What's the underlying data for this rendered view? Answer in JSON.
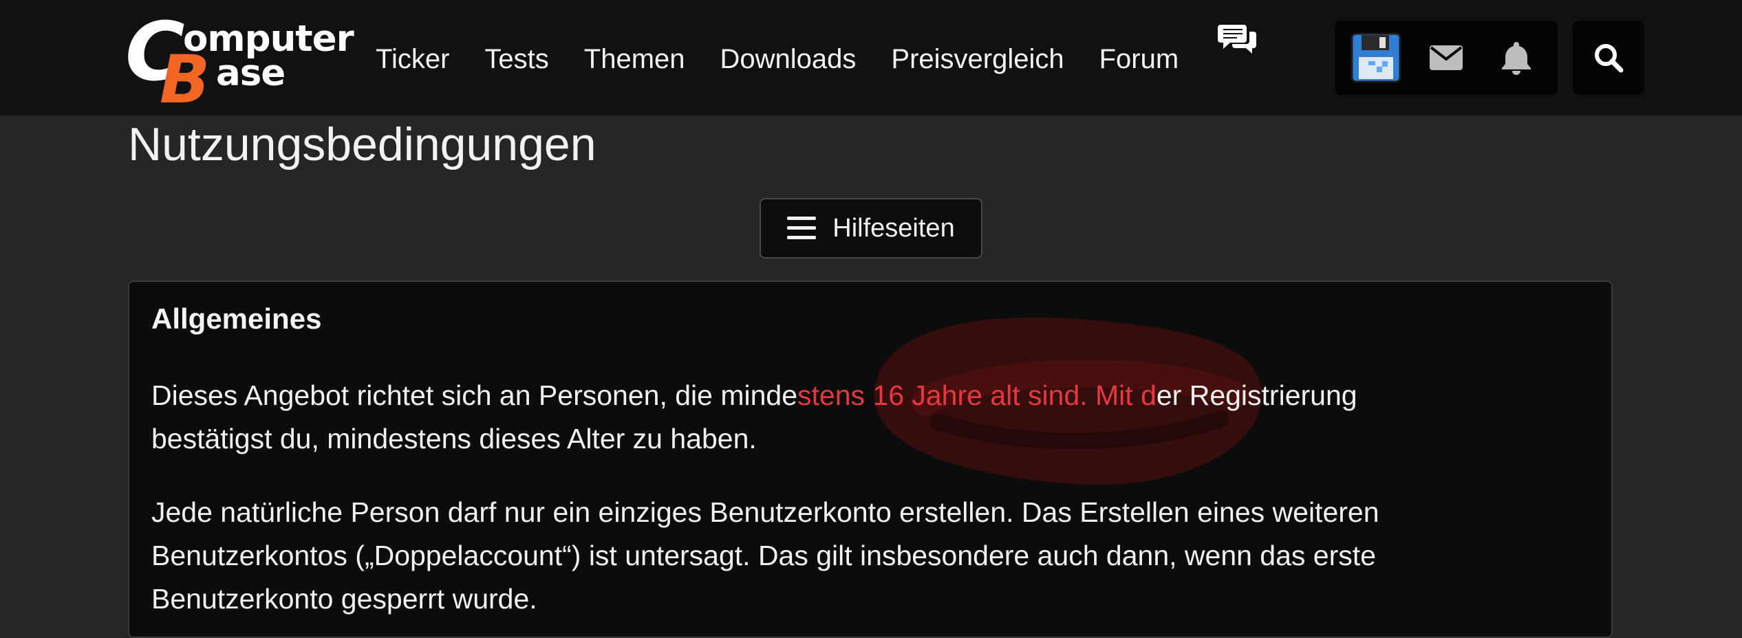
{
  "header": {
    "logo": {
      "text_big_c": "C",
      "text_omputer": "omputer",
      "text_big_b": "B",
      "text_ase": "ase"
    },
    "nav": [
      {
        "label": "Ticker"
      },
      {
        "label": "Tests"
      },
      {
        "label": "Themen"
      },
      {
        "label": "Downloads"
      },
      {
        "label": "Preisvergleich"
      },
      {
        "label": "Forum"
      }
    ],
    "tools": [
      "floppy-save-icon",
      "mail-icon",
      "bell-icon"
    ],
    "search_icon": "search-icon"
  },
  "page": {
    "title": "Nutzungsbedingungen",
    "help_button": "Hilfeseiten"
  },
  "content": {
    "section_title": "Allgemeines",
    "para1": {
      "line1_a": "Dieses Angebot richtet sich an Personen, die minde",
      "line1_highlight": "stens 16 Jahre alt sind. Mit d",
      "line1_b": "er Registrierung",
      "line2": "bestätigst du, mindestens dieses Alter zu haben."
    },
    "para2": {
      "line1": "Jede natürliche Person darf nur ein einziges Benutzerkonto erstellen. Das Erstellen eines weiteren",
      "line2": "Benutzerkontos („Doppelaccount“) ist untersagt. Das gilt insbesondere auch dann, wenn das erste",
      "line3": "Benutzerkonto gesperrt wurde."
    }
  },
  "colors": {
    "header_bg": "#111111",
    "page_bg": "#262626",
    "box_bg": "#0c0c0c",
    "logo_orange": "#f26522",
    "highlight_red": "#e8383f",
    "floppy_blue": "#2f7fd6"
  }
}
